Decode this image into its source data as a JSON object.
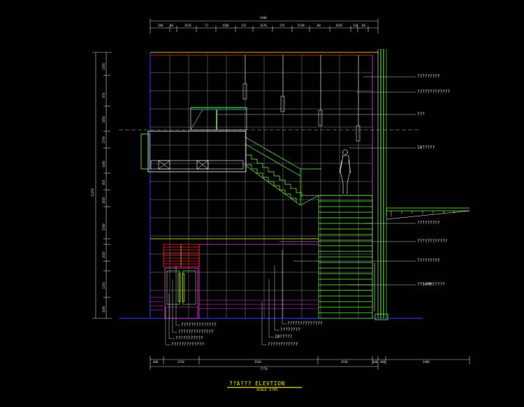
{
  "title": "??A??? ELEVTION",
  "scale": "SCALE 1?45",
  "colors": {
    "background": "#000000",
    "grid": "#c8c8c8",
    "frame_blue": "#3a3aff",
    "stair_green": "#66ff33",
    "magenta": "#ff33ff",
    "red": "#ff2020",
    "cyan": "#00ffff",
    "yellow": "#ffff33"
  },
  "dimensions": {
    "top_overall": "5400",
    "top_segments": [
      "280",
      "80",
      "1670",
      "72",
      "1560",
      "135",
      "1670",
      "135",
      "5240",
      "80",
      "1650",
      "120",
      "68"
    ],
    "left_overall": "11250",
    "left_segments": [
      "2350",
      "650",
      "1850",
      "2700",
      "1000",
      "450",
      "1650",
      "2500",
      "1650",
      "1150",
      "1600"
    ],
    "bottom_overall": "7770",
    "bottom_segments": [
      "400",
      "1550",
      "3560",
      "2930",
      "300",
      "300",
      "2400"
    ]
  },
  "callouts_right": [
    "?????????",
    "?????????????",
    "???",
    "10?????",
    "?????????",
    "????????????",
    "?????????",
    "??50MM?????"
  ],
  "callouts_bottom": [
    "??????????????",
    "??????????????",
    "???????????",
    "?????????????",
    "??????????????",
    "????????",
    "10?????",
    "????????????"
  ]
}
